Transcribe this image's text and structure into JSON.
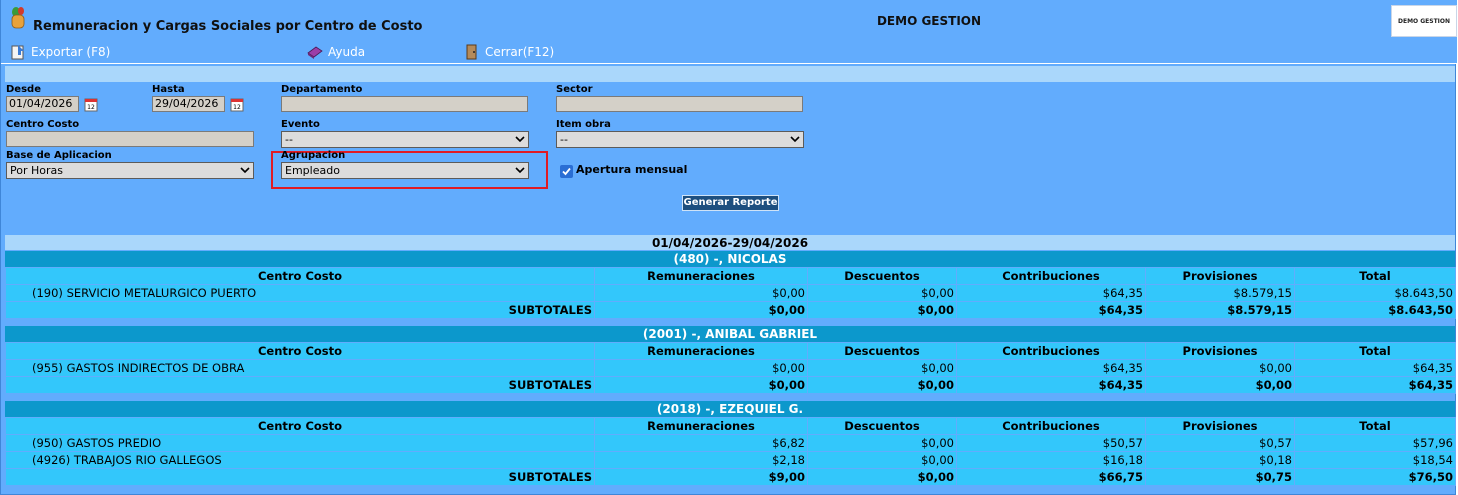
{
  "window": {
    "title": "Remuneracion y Cargas Sociales por Centro de Costo",
    "company": "DEMO GESTION",
    "logo_text": "DEMO GESTION"
  },
  "toolbar": {
    "export_label": "Exportar (F8)",
    "help_label": "Ayuda",
    "close_label": "Cerrar(F12)"
  },
  "form": {
    "desde_label": "Desde",
    "desde_value": "01/04/2026",
    "hasta_label": "Hasta",
    "hasta_value": "29/04/2026",
    "departamento_label": "Departamento",
    "departamento_value": "",
    "sector_label": "Sector",
    "sector_value": "",
    "centro_costo_label": "Centro Costo",
    "centro_costo_value": "",
    "evento_label": "Evento",
    "evento_value": "--",
    "item_obra_label": "Item obra",
    "item_obra_value": "--",
    "base_label": "Base de Aplicacion",
    "base_value": "Por Horas",
    "agrupacion_label": "Agrupacion",
    "agrupacion_value": "Empleado",
    "apertura_label": "Apertura mensual",
    "apertura_checked": true,
    "generate_label": "Generar Reporte"
  },
  "report": {
    "period": "01/04/2026-29/04/2026",
    "columns": [
      "Centro Costo",
      "Remuneraciones",
      "Descuentos",
      "Contribuciones",
      "Provisiones",
      "Total"
    ],
    "subtotal_label": "SUBTOTALES",
    "groups": [
      {
        "employee": "(480) -, NICOLAS",
        "rows": [
          [
            "(190) SERVICIO METALURGICO PUERTO",
            "$0,00",
            "$0,00",
            "$64,35",
            "$8.579,15",
            "$8.643,50"
          ]
        ],
        "subtotals": [
          "$0,00",
          "$0,00",
          "$64,35",
          "$8.579,15",
          "$8.643,50"
        ]
      },
      {
        "employee": "(2001) -, ANIBAL GABRIEL",
        "rows": [
          [
            "(955) GASTOS INDIRECTOS DE OBRA",
            "$0,00",
            "$0,00",
            "$64,35",
            "$0,00",
            "$64,35"
          ]
        ],
        "subtotals": [
          "$0,00",
          "$0,00",
          "$64,35",
          "$0,00",
          "$64,35"
        ]
      },
      {
        "employee": "(2018) -, EZEQUIEL G.",
        "rows": [
          [
            "(950) GASTOS PREDIO",
            "$6,82",
            "$0,00",
            "$50,57",
            "$0,57",
            "$57,96"
          ],
          [
            "(4926) TRABAJOS RIO GALLEGOS",
            "$2,18",
            "$0,00",
            "$16,18",
            "$0,18",
            "$18,54"
          ]
        ],
        "subtotals": [
          "$9,00",
          "$0,00",
          "$66,75",
          "$0,75",
          "$76,50"
        ]
      }
    ]
  }
}
